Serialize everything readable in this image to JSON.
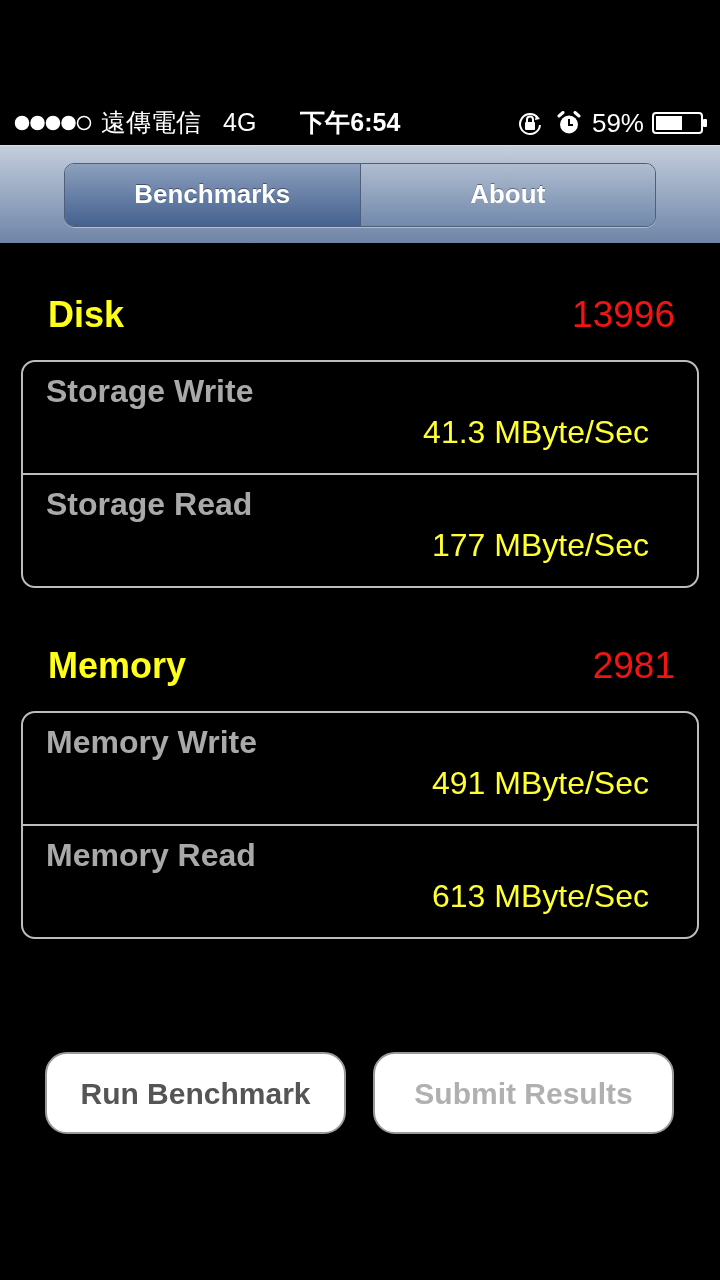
{
  "status_bar": {
    "carrier": "遠傳電信",
    "network": "4G",
    "time": "下午6:54",
    "battery": "59%"
  },
  "tabs": [
    {
      "label": "Benchmarks",
      "selected": true
    },
    {
      "label": "About",
      "selected": false
    }
  ],
  "sections": [
    {
      "title": "Disk",
      "score": "13996",
      "rows": [
        {
          "label": "Storage Write",
          "value": "41.3 MByte/Sec"
        },
        {
          "label": "Storage Read",
          "value": "177 MByte/Sec"
        }
      ]
    },
    {
      "title": "Memory",
      "score": "2981",
      "rows": [
        {
          "label": "Memory Write",
          "value": "491 MByte/Sec"
        },
        {
          "label": "Memory Read",
          "value": "613 MByte/Sec"
        }
      ]
    }
  ],
  "buttons": [
    {
      "label": "Run Benchmark",
      "disabled": false
    },
    {
      "label": "Submit Results",
      "disabled": true
    }
  ]
}
